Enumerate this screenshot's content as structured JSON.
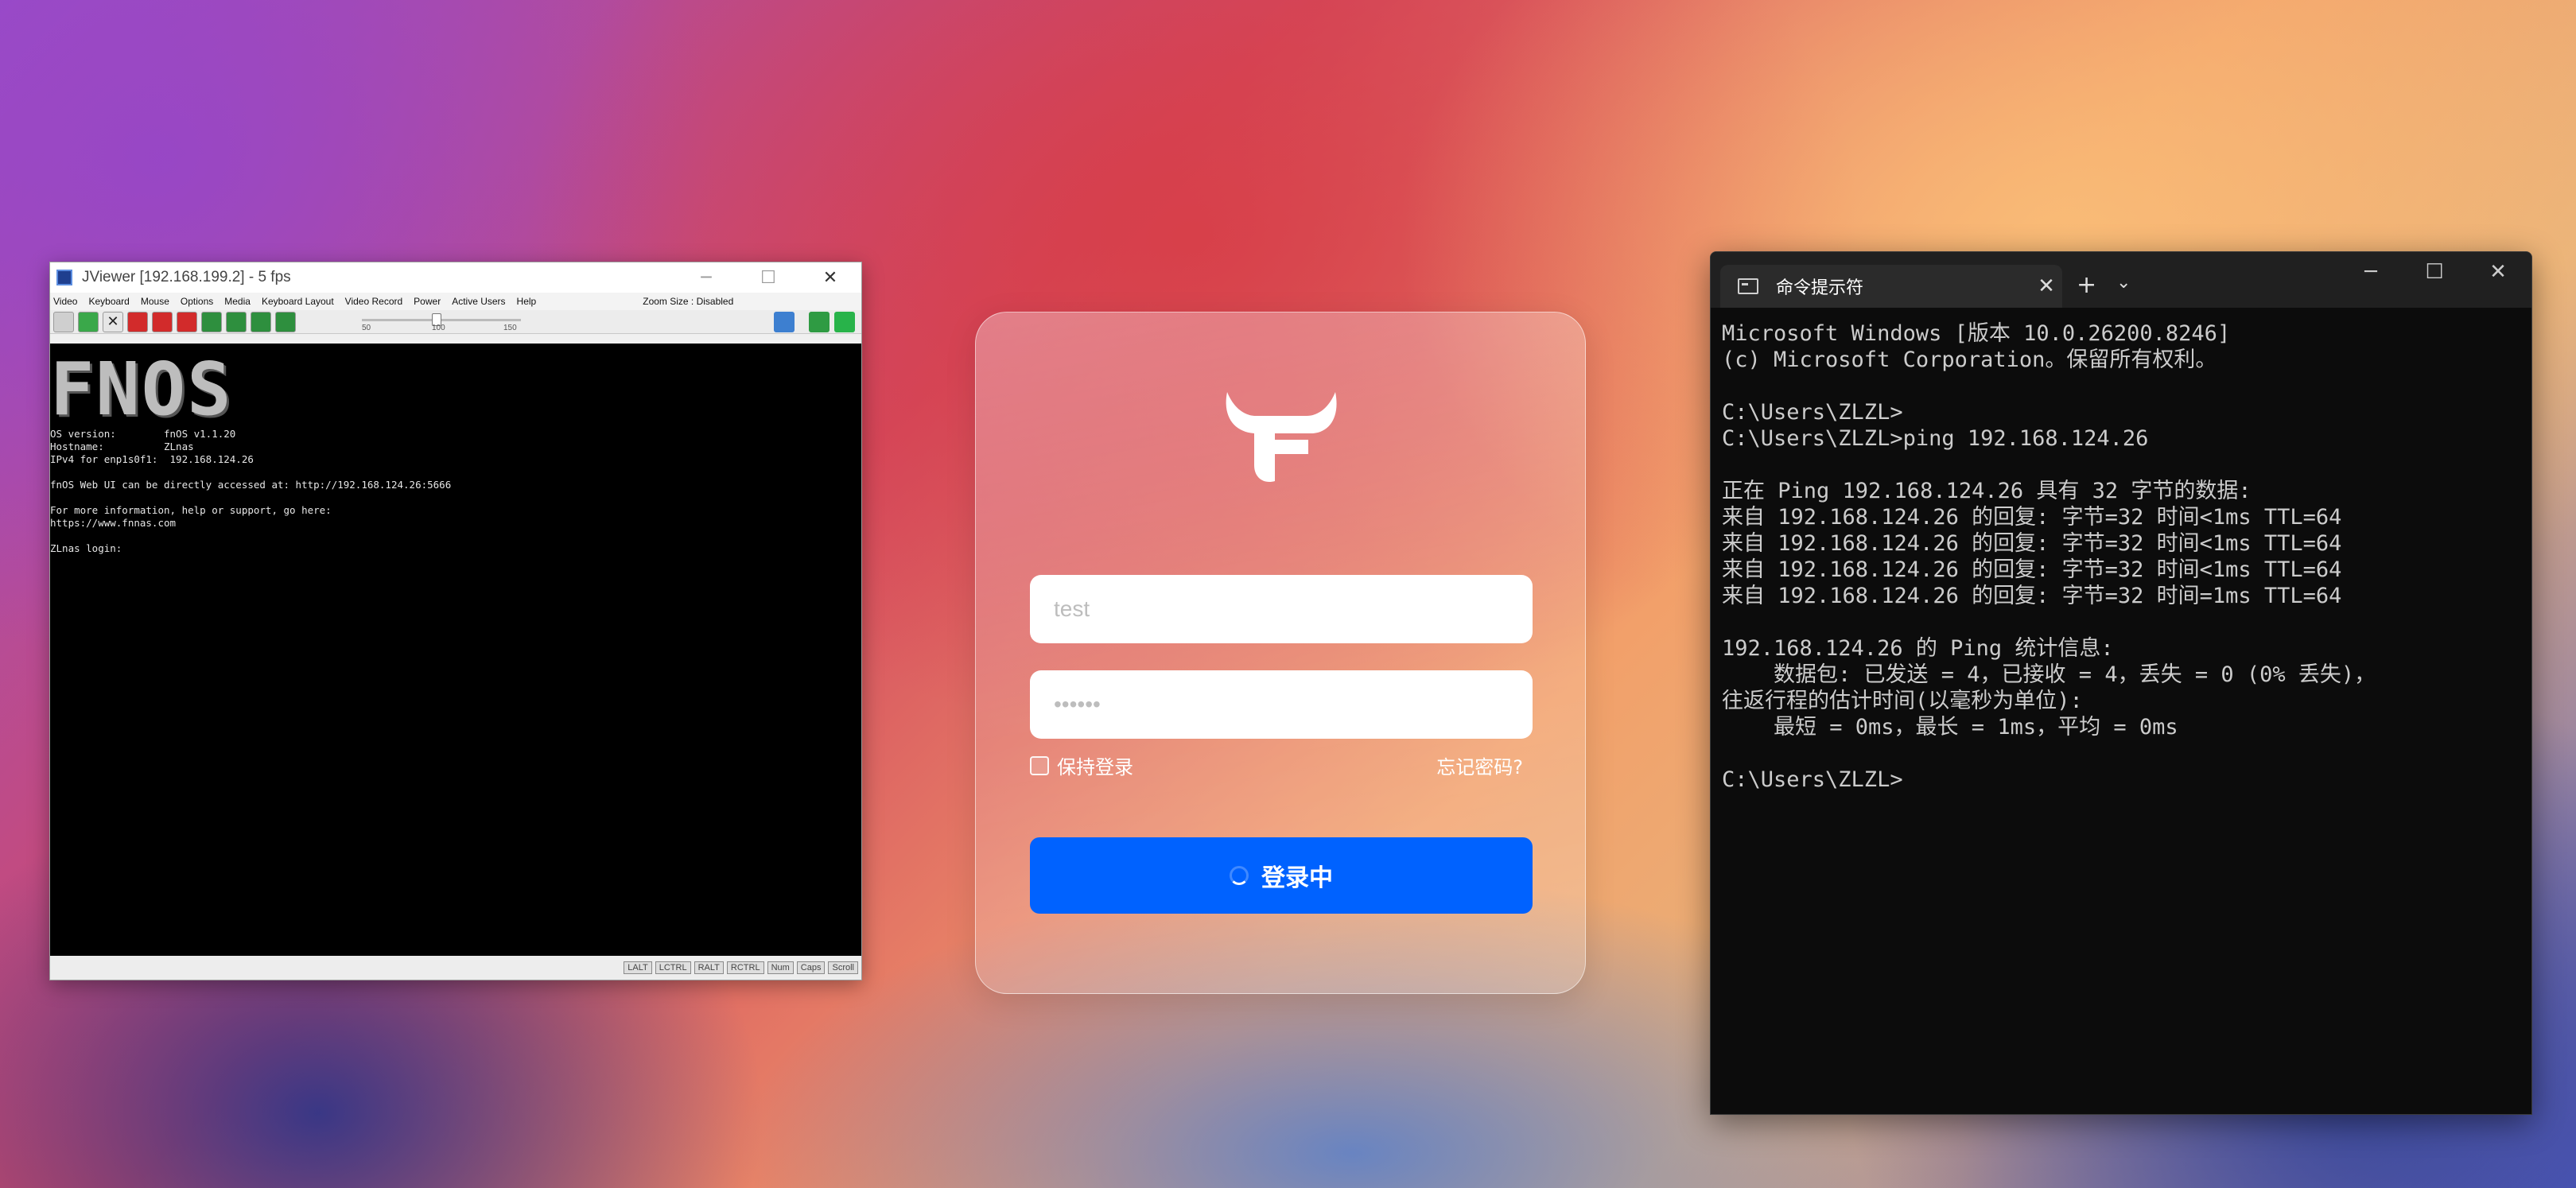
{
  "jviewer": {
    "title": "JViewer [192.168.199.2] - 5 fps",
    "minimize": "─",
    "maximize": "☐",
    "close": "✕",
    "menu": [
      "Video",
      "Keyboard",
      "Mouse",
      "Options",
      "Media",
      "Keyboard Layout",
      "Video Record",
      "Power",
      "Active Users",
      "Help"
    ],
    "zoom_size": "Zoom Size : Disabled",
    "slider_labels": [
      "50",
      "100",
      "150"
    ],
    "screen": {
      "logo": "FNOS",
      "lines": [
        "OS version:        fnOS v1.1.20",
        "Hostname:          ZLnas",
        "IPv4 for enp1s0f1:  192.168.124.26",
        "",
        "fnOS Web UI can be directly accessed at: http://192.168.124.26:5666",
        "",
        "For more information, help or support, go here:",
        "https://www.fnnas.com",
        "",
        "ZLnas login:"
      ]
    },
    "status_keys": [
      "LALT",
      "LCTRL",
      "RALT",
      "RCTRL",
      "Num",
      "Caps",
      "Scroll"
    ]
  },
  "login": {
    "username_placeholder": "test",
    "password_placeholder": "••••••",
    "remember_label": "保持登录",
    "forgot_label": "忘记密码?",
    "submit_label": "登录中",
    "accent": "#0062ff"
  },
  "cmd": {
    "tab_title": "命令提示符",
    "tab_close": "✕",
    "new_tab": "+",
    "dropdown": "⌄",
    "minimize": "─",
    "maximize": "☐",
    "close": "✕",
    "output": "Microsoft Windows [版本 10.0.26200.8246]\n(c) Microsoft Corporation。保留所有权利。\n\nC:\\Users\\ZLZL>\nC:\\Users\\ZLZL>ping 192.168.124.26\n\n正在 Ping 192.168.124.26 具有 32 字节的数据:\n来自 192.168.124.26 的回复: 字节=32 时间<1ms TTL=64\n来自 192.168.124.26 的回复: 字节=32 时间<1ms TTL=64\n来自 192.168.124.26 的回复: 字节=32 时间<1ms TTL=64\n来自 192.168.124.26 的回复: 字节=32 时间=1ms TTL=64\n\n192.168.124.26 的 Ping 统计信息:\n    数据包: 已发送 = 4，已接收 = 4，丢失 = 0 (0% 丢失)，\n往返行程的估计时间(以毫秒为单位):\n    最短 = 0ms，最长 = 1ms，平均 = 0ms\n\nC:\\Users\\ZLZL>"
  }
}
